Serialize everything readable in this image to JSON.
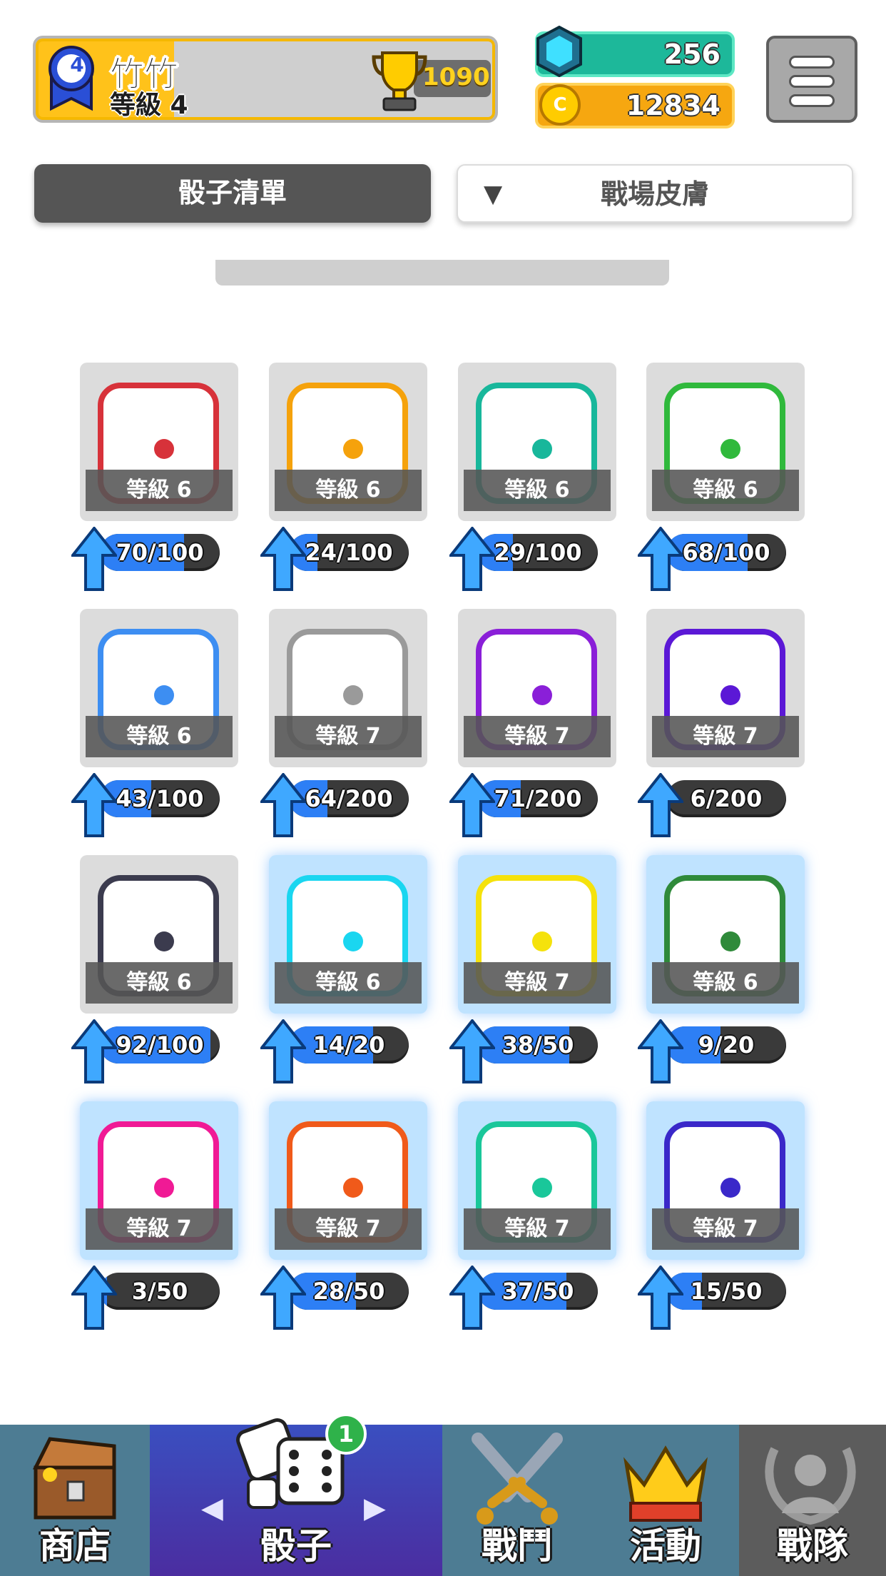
{
  "header": {
    "player_name": "竹竹",
    "player_level": "等級 4",
    "rank_number": "4",
    "trophies": "1090",
    "gems": "256",
    "coins": "12834",
    "coin_symbol": "C"
  },
  "tabs": {
    "dice_list": "骰子清單",
    "arena_skin_arrow": "▼",
    "arena_skin": "戰場皮膚"
  },
  "dice": [
    {
      "color": "#d7323a",
      "level": "等級 6",
      "progress": "70/100",
      "fill": 0.7,
      "legend": false
    },
    {
      "color": "#f5a20c",
      "level": "等級 6",
      "progress": "24/100",
      "fill": 0.24,
      "legend": false
    },
    {
      "color": "#18b79b",
      "level": "等級 6",
      "progress": "29/100",
      "fill": 0.29,
      "legend": false
    },
    {
      "color": "#30b93c",
      "level": "等級 6",
      "progress": "68/100",
      "fill": 0.68,
      "legend": false
    },
    {
      "color": "#3d8ef2",
      "level": "等級 6",
      "progress": "43/100",
      "fill": 0.43,
      "legend": false
    },
    {
      "color": "#9a9a9a",
      "level": "等級 7",
      "progress": "64/200",
      "fill": 0.32,
      "legend": false
    },
    {
      "color": "#8a1fd8",
      "level": "等級 7",
      "progress": "71/200",
      "fill": 0.355,
      "legend": false
    },
    {
      "color": "#5b18d6",
      "level": "等級 7",
      "progress": "6/200",
      "fill": 0.03,
      "legend": false
    },
    {
      "color": "#3b3b4e",
      "level": "等級 6",
      "progress": "92/100",
      "fill": 0.92,
      "legend": false
    },
    {
      "color": "#1ad6f0",
      "level": "等級 6",
      "progress": "14/20",
      "fill": 0.7,
      "legend": true
    },
    {
      "color": "#f5e20c",
      "level": "等級 7",
      "progress": "38/50",
      "fill": 0.76,
      "legend": true
    },
    {
      "color": "#2f8a3a",
      "level": "等級 6",
      "progress": "9/20",
      "fill": 0.45,
      "legend": true
    },
    {
      "color": "#f01a95",
      "level": "等級 7",
      "progress": "3/50",
      "fill": 0.06,
      "legend": true
    },
    {
      "color": "#f05a1a",
      "level": "等級 7",
      "progress": "28/50",
      "fill": 0.56,
      "legend": true
    },
    {
      "color": "#1ac79a",
      "level": "等級 7",
      "progress": "37/50",
      "fill": 0.74,
      "legend": true
    },
    {
      "color": "#3a28c9",
      "level": "等級 7",
      "progress": "15/50",
      "fill": 0.3,
      "legend": true
    }
  ],
  "nav": {
    "shop": "商店",
    "dice": "骰子",
    "battle": "戰鬥",
    "event": "活動",
    "clan": "戰隊",
    "dice_badge": "1",
    "prev_arrow": "◀",
    "next_arrow": "▶"
  }
}
